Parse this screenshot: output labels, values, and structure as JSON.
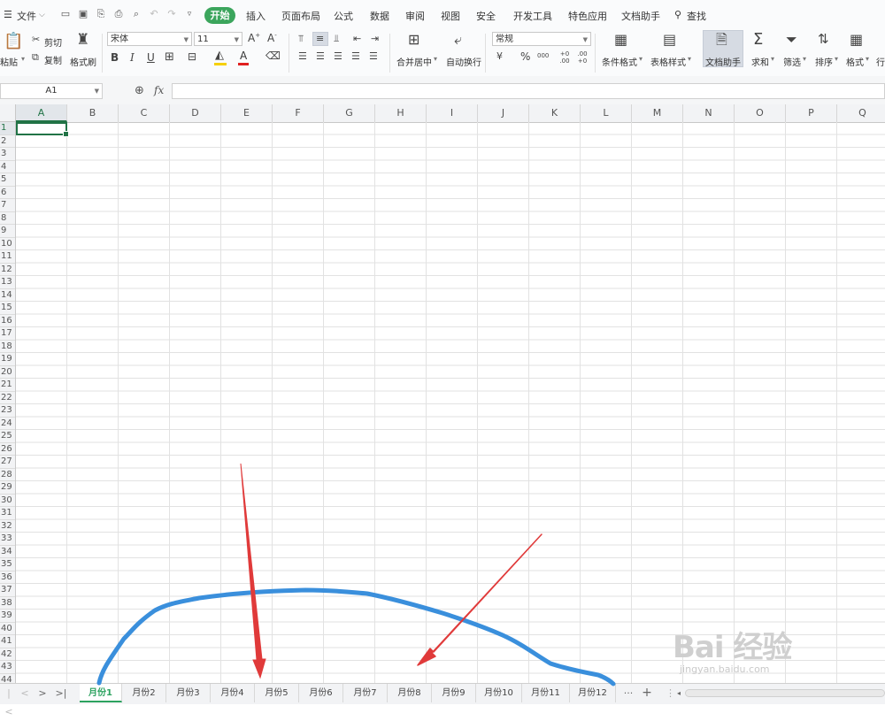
{
  "menu": {
    "file_label": "文件",
    "items": [
      "开始",
      "插入",
      "页面布局",
      "公式",
      "数据",
      "审阅",
      "视图",
      "安全",
      "开发工具",
      "特色应用",
      "文档助手"
    ],
    "active": "开始",
    "search_label": "查找"
  },
  "ribbon": {
    "paste": "粘贴",
    "cut": "剪切",
    "copy": "复制",
    "format_painter": "格式刷",
    "font_name": "宋体",
    "font_size": "11",
    "bold": "B",
    "italic": "I",
    "underline": "U",
    "merge_center": "合并居中",
    "wrap_text": "自动换行",
    "number_format": "常规",
    "currency_symbol": "¥",
    "percent_symbol": "%",
    "thousands_symbol": "000",
    "increase_decimal": "+0 .00",
    "decrease_decimal": ".00 +0",
    "conditional_format": "条件格式",
    "table_style": "表格样式",
    "doc_assistant": "文档助手",
    "sum": "求和",
    "filter": "筛选",
    "sort": "排序",
    "format": "格式",
    "row_col": "行"
  },
  "formula_bar": {
    "name_box": "A1",
    "fx_label": "fx",
    "value": ""
  },
  "grid": {
    "columns": [
      "A",
      "B",
      "C",
      "D",
      "E",
      "F",
      "G",
      "H",
      "I",
      "J",
      "K",
      "L",
      "M",
      "N",
      "O",
      "P",
      "Q"
    ],
    "rows": [
      "1",
      "2",
      "3",
      "4",
      "5",
      "6",
      "7",
      "8",
      "9",
      "10",
      "11",
      "12",
      "13",
      "14",
      "15",
      "16",
      "17",
      "18",
      "19",
      "20",
      "21",
      "22",
      "23",
      "24",
      "25",
      "26",
      "27",
      "28",
      "29",
      "30",
      "31",
      "32",
      "33",
      "34",
      "35",
      "36",
      "37",
      "38",
      "39",
      "40",
      "41",
      "42",
      "43",
      "44"
    ],
    "selected_cell": "A1"
  },
  "sheet_tabs": {
    "tabs": [
      "月份1",
      "月份2",
      "月份3",
      "月份4",
      "月份5",
      "月份6",
      "月份7",
      "月份8",
      "月份9",
      "月份10",
      "月份11",
      "月份12"
    ],
    "active": "月份1",
    "more": "···",
    "add": "+"
  },
  "colors": {
    "accent_green": "#3ba55c",
    "annotation_blue": "#3a8fdc",
    "annotation_red": "#e03a3a"
  },
  "watermark": {
    "main": "Bai 经验",
    "sub": "jingyan.baidu.com"
  }
}
